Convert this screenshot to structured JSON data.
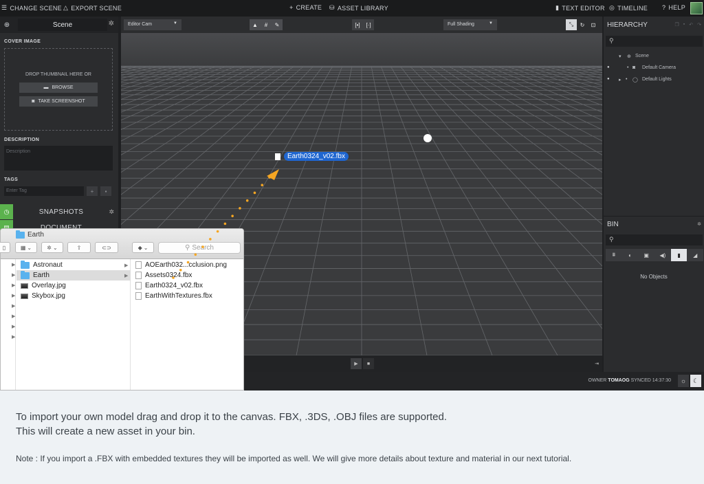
{
  "topbar": {
    "change_scene": "CHANGE SCENE",
    "export_scene": "EXPORT SCENE",
    "create": "CREATE",
    "asset_library": "ASSET LIBRARY",
    "text_editor": "TEXT EDITOR",
    "timeline": "TIMELINE",
    "help": "HELP"
  },
  "left_panel": {
    "scene_name": "Scene",
    "cover_image_label": "COVER IMAGE",
    "drop_text": "DROP THUMBNAIL HERE OR",
    "browse_label": "BROWSE",
    "screenshot_label": "TAKE SCREENSHOT",
    "description_label": "DESCRIPTION",
    "description_placeholder": "Description",
    "tags_label": "TAGS",
    "tag_placeholder": "Enter Tag",
    "tag_add": "+",
    "snapshots_label": "SNAPSHOTS",
    "document_label": "DOCUMENT"
  },
  "viewport": {
    "camera_select": "Editor Cam",
    "shading_select": "Full Shading",
    "dragged_file": "Earth0324_v02.fbx"
  },
  "status": {
    "owner_label": "OWNER",
    "owner_name": "TOMAOG",
    "synced": "SYNCED 14:37:30"
  },
  "hierarchy": {
    "title": "HIERARCHY",
    "items": [
      "Scene",
      "Default Camera",
      "Default Lights"
    ]
  },
  "bin": {
    "title": "BIN",
    "empty_text": "No Objects"
  },
  "finder": {
    "title": "Earth",
    "search_placeholder": "Search",
    "column1": [
      "Astronaut",
      "Earth",
      "Overlay.jpg",
      "Skybox.jpg"
    ],
    "column2": [
      "AOEarth032...cclusion.png",
      "Assets0324.fbx",
      "Earth0324_v02.fbx",
      "EarthWithTextures.fbx"
    ]
  },
  "caption": {
    "line1": "To import your own model drag and drop it to the canvas. FBX, .3DS, .OBJ files are supported.",
    "line2": "This will create a new asset in your bin.",
    "note": "Note : If you import a .FBX with embedded textures they will be imported as well. We will give more details about texture and material in our next tutorial."
  },
  "colors": {
    "accent_green": "#5bb24d",
    "drag_arrow": "#f5a623",
    "selection_blue": "#1f66d0",
    "folder_blue": "#59b2ee"
  }
}
